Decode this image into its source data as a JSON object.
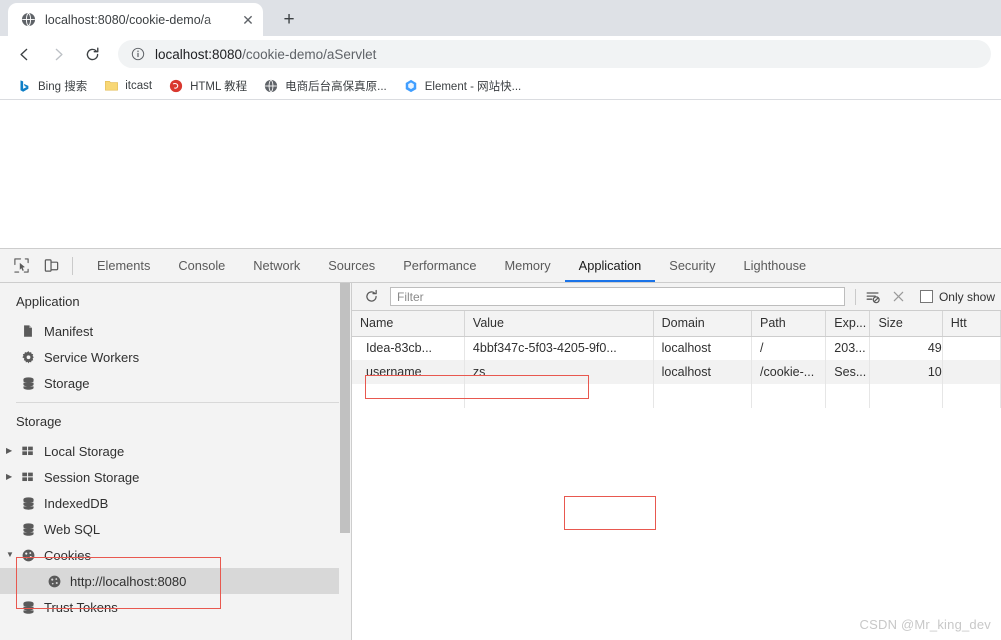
{
  "browser": {
    "tab": {
      "title": "localhost:8080/cookie-demo/a",
      "favicon": "globe-icon",
      "close": "✕"
    },
    "newtab_label": "+",
    "nav": {
      "back": "←",
      "forward": "→",
      "reload": "↻"
    },
    "omnibox": {
      "info_icon": "info-circle-icon",
      "url_bold": "localhost:8080",
      "url_rest": "/cookie-demo/aServlet",
      "url_full": "localhost:8080/cookie-demo/aServlet"
    },
    "bookmarks": [
      {
        "label": "Bing 搜索",
        "icon": "bing-icon"
      },
      {
        "label": "itcast",
        "icon": "folder-icon"
      },
      {
        "label": "HTML 教程",
        "icon": "runoob-icon"
      },
      {
        "label": "电商后台高保真原...",
        "icon": "globe-icon"
      },
      {
        "label": "Element - 网站快...",
        "icon": "element-icon"
      }
    ]
  },
  "devtools": {
    "toolbar_icons": [
      {
        "name": "inspect-element-icon"
      },
      {
        "name": "device-toolbar-icon"
      }
    ],
    "tabs": [
      {
        "label": "Elements",
        "active": false
      },
      {
        "label": "Console",
        "active": false
      },
      {
        "label": "Network",
        "active": false
      },
      {
        "label": "Sources",
        "active": false
      },
      {
        "label": "Performance",
        "active": false
      },
      {
        "label": "Memory",
        "active": false
      },
      {
        "label": "Application",
        "active": true
      },
      {
        "label": "Security",
        "active": false
      },
      {
        "label": "Lighthouse",
        "active": false
      }
    ],
    "sidebar": {
      "application_heading": "Application",
      "application_items": [
        {
          "label": "Manifest",
          "icon": "document-icon",
          "arrow": "",
          "selected": false
        },
        {
          "label": "Service Workers",
          "icon": "gear-icon",
          "arrow": "",
          "selected": false
        },
        {
          "label": "Storage",
          "icon": "database-icon",
          "arrow": "",
          "selected": false
        }
      ],
      "storage_heading": "Storage",
      "storage_items": [
        {
          "label": "Local Storage",
          "icon": "table-icon",
          "arrow": "▶",
          "selected": false,
          "indent": 1
        },
        {
          "label": "Session Storage",
          "icon": "table-icon",
          "arrow": "▶",
          "selected": false,
          "indent": 1
        },
        {
          "label": "IndexedDB",
          "icon": "database-icon",
          "arrow": "",
          "selected": false,
          "indent": 1
        },
        {
          "label": "Web SQL",
          "icon": "database-icon",
          "arrow": "",
          "selected": false,
          "indent": 1
        },
        {
          "label": "Cookies",
          "icon": "cookie-icon",
          "arrow": "▼",
          "selected": false,
          "indent": 1
        },
        {
          "label": "http://localhost:8080",
          "icon": "cookie-icon",
          "arrow": "",
          "selected": true,
          "indent": 2
        },
        {
          "label": "Trust Tokens",
          "icon": "database-icon",
          "arrow": "",
          "selected": false,
          "indent": 1
        }
      ]
    },
    "filterbar": {
      "refresh_icon": "refresh-icon",
      "filter_placeholder": "Filter",
      "filter_value": "",
      "clear_filter_icon": "clear-filter-icon",
      "clear_all_icon": "close-x-icon",
      "only_show_label": "Only show",
      "only_show_checked": false
    },
    "table": {
      "columns": [
        "Name",
        "Value",
        "Domain",
        "Path",
        "Exp...",
        "Size",
        "Htt"
      ],
      "rows": [
        {
          "name": "Idea-83cb...",
          "value": "4bbf347c-5f03-4205-9f0...",
          "domain": "localhost",
          "path": "/",
          "expires": "203...",
          "size": "49",
          "httponly": ""
        },
        {
          "name": "username",
          "value": "zs",
          "domain": "localhost",
          "path": "/cookie-...",
          "expires": "Ses...",
          "size": "10",
          "httponly": ""
        }
      ]
    }
  },
  "annotations": {
    "color": "#e8584f",
    "items": [
      "application-tab",
      "cookies-tree-node",
      "username-cookie-row"
    ]
  },
  "watermark": "CSDN @Mr_king_dev"
}
